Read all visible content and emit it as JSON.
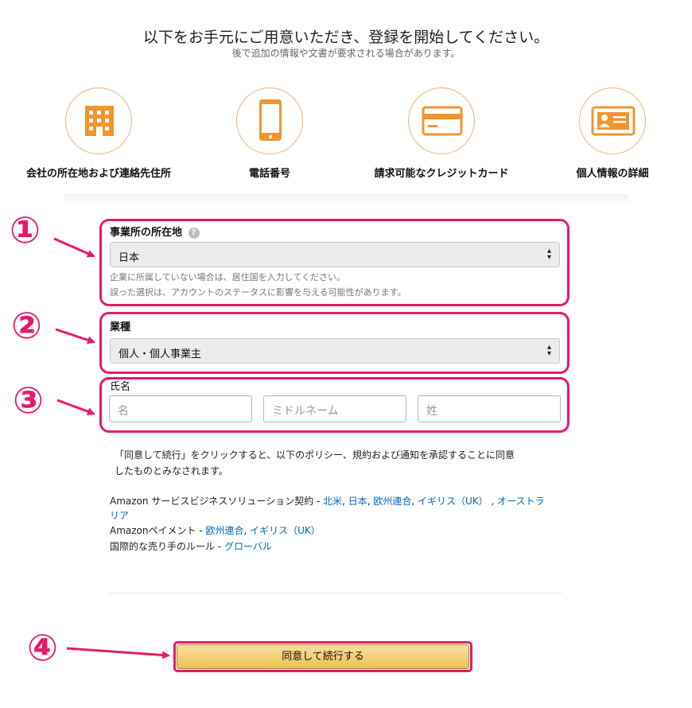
{
  "header": {
    "title": "以下をお手元にご用意いただき、登録を開始してください。",
    "subtitle": "後で追加の情報や文書が要求される場合があります。"
  },
  "requirements": [
    {
      "label": "会社の所在地および連絡先住所",
      "icon": "building-icon"
    },
    {
      "label": "電話番号",
      "icon": "phone-icon"
    },
    {
      "label": "請求可能なクレジットカード",
      "icon": "credit-card-icon"
    },
    {
      "label": "個人情報の詳細",
      "icon": "id-card-icon"
    }
  ],
  "form": {
    "location": {
      "label": "事業所の所在地",
      "value": "日本",
      "hint1": "企業に所属していない場合は、居住国を入力してください。",
      "hint2": "誤った選択は、アカウントのステータスに影響を与える可能性があります。"
    },
    "business_type": {
      "label": "業種",
      "value": "個人・個人事業主"
    },
    "name": {
      "label": "氏名",
      "first_placeholder": "名",
      "middle_placeholder": "ミドルネーム",
      "last_placeholder": "姓"
    }
  },
  "agreement": {
    "line1": "「同意して続行」をクリックすると、以下のポリシー、規約および通知を承認することに同意",
    "line2": "したものとみなされます。",
    "bss_prefix": "Amazon サービスビジネスソリューション契約 - ",
    "bss_links": [
      "北米",
      "日本",
      "欧州連合",
      "イギリス（UK）",
      "オーストラ"
    ],
    "bss_link_cont": "リア",
    "sep": ", ",
    "sep2": " , ",
    "pay_prefix": "Amazonペイメント - ",
    "pay_links": [
      "欧州連合",
      "イギリス（UK）"
    ],
    "rules_prefix": "国際的な売り手のルール - ",
    "rules_link": "グローバル"
  },
  "cta": {
    "label": "同意して続行する"
  },
  "annotations": {
    "n1": "①",
    "n2": "②",
    "n3": "③",
    "n4": "④"
  },
  "colors": {
    "accent": "#e8196b",
    "icon_orange": "#f0962e",
    "link": "#0066c0",
    "button": "#f0c14b"
  }
}
